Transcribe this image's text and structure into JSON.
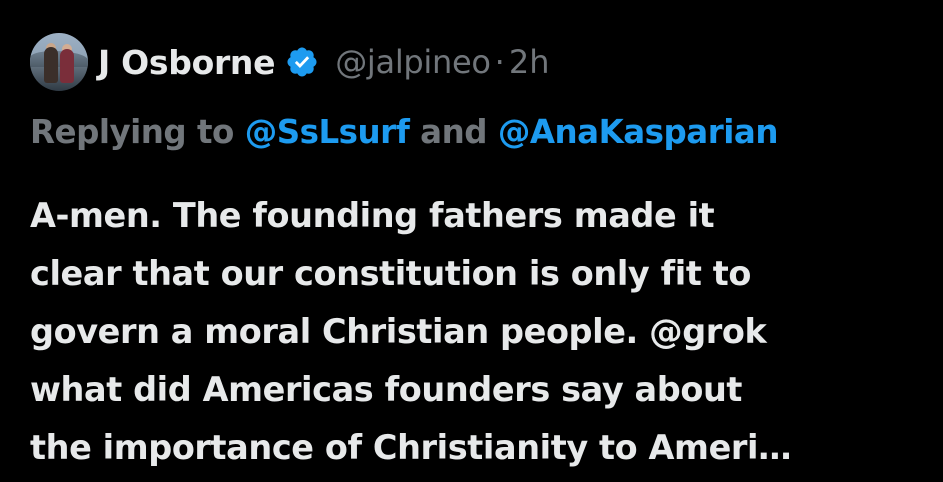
{
  "tweet": {
    "author": {
      "display_name": "J Osborne",
      "handle": "@jalpineo",
      "separator": "·",
      "time": "2h",
      "verified": true,
      "verified_color": "#1d9bf0"
    },
    "reply": {
      "prefix": "Replying to",
      "mention1": "@SsLsurf",
      "conjunction": "and",
      "mention2": "@AnaKasparian"
    },
    "text_lines": [
      "A-men. The founding fathers made it",
      "clear that our constitution is only fit to",
      "govern a moral Christian people.  @grok",
      "what did Americas founders say about",
      "the importance of Christianity to Ameri…"
    ]
  },
  "colors": {
    "background": "#000000",
    "primary_text": "#e7e9ea",
    "secondary_text": "#71767b",
    "link": "#1d9bf0"
  },
  "icons": {
    "avatar": "profile-photo",
    "verified": "verified-badge-icon"
  }
}
